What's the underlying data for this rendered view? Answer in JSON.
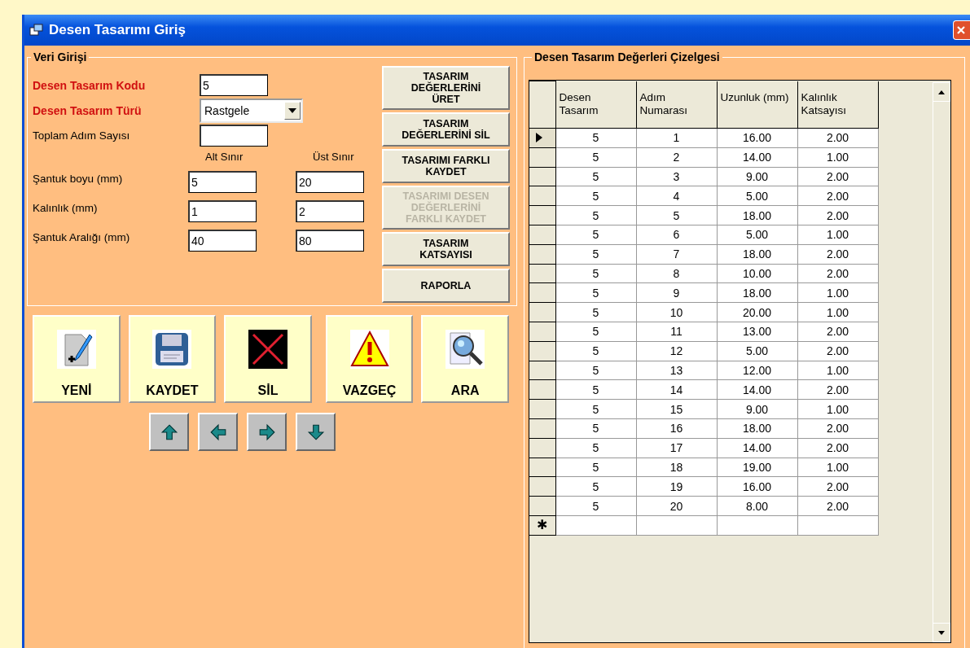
{
  "window": {
    "title": "Desen Tasarımı Giriş"
  },
  "entry_panel": {
    "title": "Veri Girişi",
    "fields": [
      {
        "label": "Desen Tasarım Kodu",
        "required": true,
        "kind": "text",
        "value": "5"
      },
      {
        "label": "Desen Tasarım Türü",
        "required": true,
        "kind": "combo",
        "value": "Rastgele"
      },
      {
        "label": "Toplam Adım Sayısı",
        "required": false,
        "kind": "text"
      }
    ],
    "range_headers": [
      "Alt Sınır",
      "Üst Sınır"
    ],
    "ranges": [
      {
        "label": "Şantuk boyu (mm)",
        "min": "5",
        "max": "20"
      },
      {
        "label": "Kalınlık (mm)",
        "min": "1",
        "max": "2"
      },
      {
        "label": "Şantuk Aralığı (mm)",
        "min": "40",
        "max": "80"
      }
    ],
    "actions": [
      {
        "label": "TASARIM DEĞERLERİNİ ÜRET",
        "disabled": false
      },
      {
        "label": "TASARIM DEĞERLERİNİ SİL",
        "disabled": false
      },
      {
        "label": "TASARIMI FARKLI KAYDET",
        "disabled": false
      },
      {
        "label": "TASARIMI DESEN DEĞERLERİNİ FARKLI KAYDET",
        "disabled": true
      },
      {
        "label": "TASARIM KATSAYISI",
        "disabled": false
      },
      {
        "label": "RAPORLA",
        "disabled": false
      }
    ]
  },
  "toolbar": [
    {
      "label": "YENİ",
      "kind": "new"
    },
    {
      "label": "KAYDET",
      "kind": "save"
    },
    {
      "label": "SİL",
      "kind": "delete"
    },
    {
      "label": "VAZGEÇ",
      "kind": "cancel"
    },
    {
      "label": "ARA",
      "kind": "search"
    }
  ],
  "navigation": [
    {
      "kind": "up"
    },
    {
      "kind": "left"
    },
    {
      "kind": "right"
    },
    {
      "kind": "down"
    }
  ],
  "grid_panel": {
    "title": "Desen Tasarım Değerleri Çizelgesi",
    "columns": [
      "Desen Tasarım",
      "Adım Numarası",
      "Uzunluk (mm)",
      "Kalınlık Katsayısı"
    ],
    "rows": [
      {
        "current": true,
        "cells": [
          "5",
          "1",
          "16.00",
          "2.00"
        ]
      },
      {
        "current": false,
        "cells": [
          "5",
          "2",
          "14.00",
          "1.00"
        ]
      },
      {
        "current": false,
        "cells": [
          "5",
          "3",
          "9.00",
          "2.00"
        ]
      },
      {
        "current": false,
        "cells": [
          "5",
          "4",
          "5.00",
          "2.00"
        ]
      },
      {
        "current": false,
        "cells": [
          "5",
          "5",
          "18.00",
          "2.00"
        ]
      },
      {
        "current": false,
        "cells": [
          "5",
          "6",
          "5.00",
          "1.00"
        ]
      },
      {
        "current": false,
        "cells": [
          "5",
          "7",
          "18.00",
          "2.00"
        ]
      },
      {
        "current": false,
        "cells": [
          "5",
          "8",
          "10.00",
          "2.00"
        ]
      },
      {
        "current": false,
        "cells": [
          "5",
          "9",
          "18.00",
          "1.00"
        ]
      },
      {
        "current": false,
        "cells": [
          "5",
          "10",
          "20.00",
          "1.00"
        ]
      },
      {
        "current": false,
        "cells": [
          "5",
          "11",
          "13.00",
          "2.00"
        ]
      },
      {
        "current": false,
        "cells": [
          "5",
          "12",
          "5.00",
          "2.00"
        ]
      },
      {
        "current": false,
        "cells": [
          "5",
          "13",
          "12.00",
          "1.00"
        ]
      },
      {
        "current": false,
        "cells": [
          "5",
          "14",
          "14.00",
          "2.00"
        ]
      },
      {
        "current": false,
        "cells": [
          "5",
          "15",
          "9.00",
          "1.00"
        ]
      },
      {
        "current": false,
        "cells": [
          "5",
          "16",
          "18.00",
          "2.00"
        ]
      },
      {
        "current": false,
        "cells": [
          "5",
          "17",
          "14.00",
          "2.00"
        ]
      },
      {
        "current": false,
        "cells": [
          "5",
          "18",
          "19.00",
          "1.00"
        ]
      },
      {
        "current": false,
        "cells": [
          "5",
          "19",
          "16.00",
          "2.00"
        ]
      },
      {
        "current": false,
        "cells": [
          "5",
          "20",
          "8.00",
          "2.00"
        ]
      }
    ],
    "new_row_marker": "✱"
  }
}
